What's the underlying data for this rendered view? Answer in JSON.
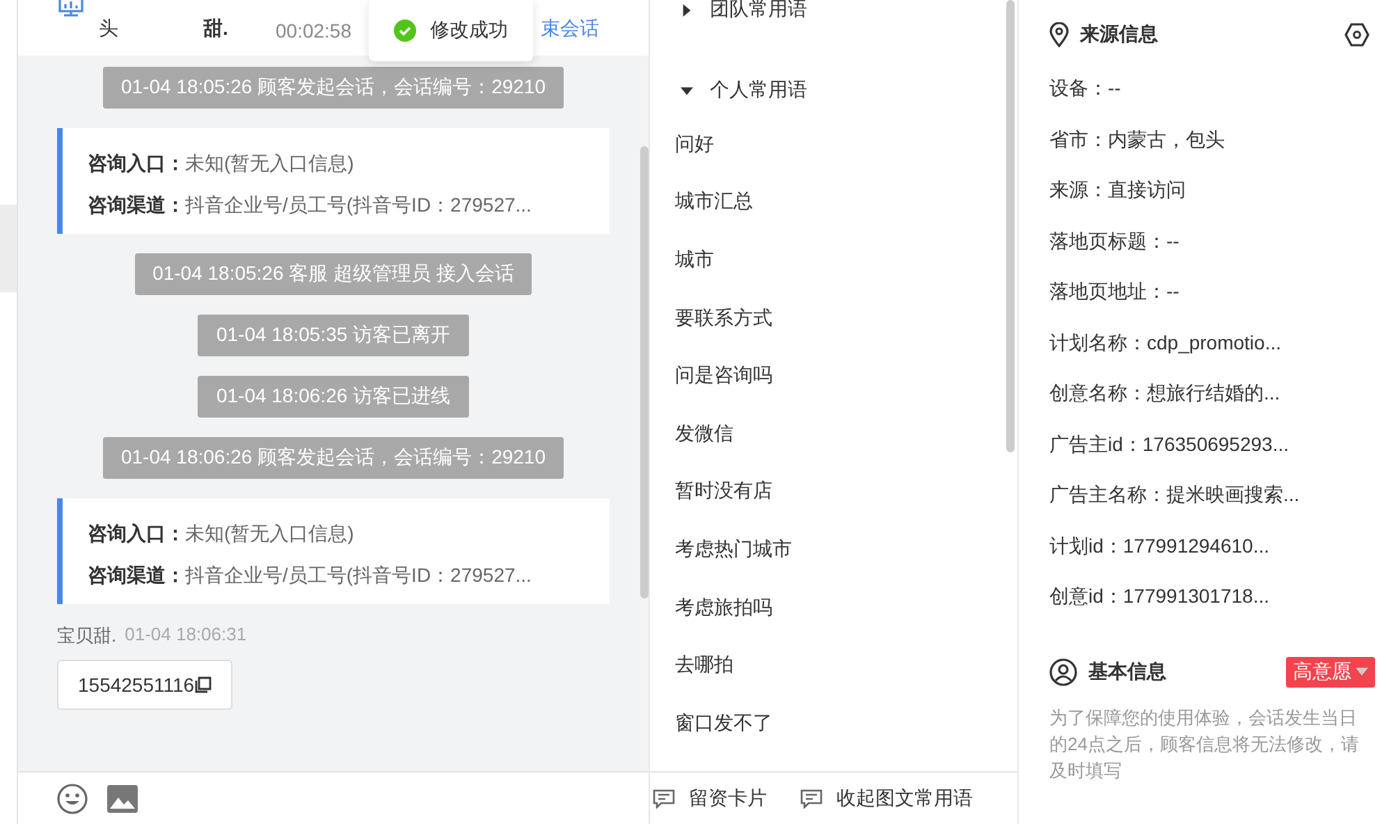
{
  "chat": {
    "header": {
      "name_tail": "头",
      "customer_tail": "甜.",
      "duration": "00:02:58",
      "end_link": "束会话"
    },
    "toast": {
      "text": "修改成功"
    },
    "messages": [
      {
        "kind": "system",
        "text": "01-04 18:05:26 顾客发起会话，会话编号：29210"
      },
      {
        "kind": "info",
        "lines": [
          {
            "label": "咨询入口：",
            "value": "未知(暂无入口信息)"
          },
          {
            "label": "咨询渠道：",
            "value": "抖音企业号/员工号(抖音号ID：279527..."
          }
        ]
      },
      {
        "kind": "system",
        "text": "01-04 18:05:26 客服 超级管理员 接入会话"
      },
      {
        "kind": "system",
        "text": "01-04 18:05:35 访客已离开"
      },
      {
        "kind": "system",
        "text": "01-04 18:06:26 访客已进线"
      },
      {
        "kind": "system",
        "text": "01-04 18:06:26 顾客发起会话，会话编号：29210"
      },
      {
        "kind": "info",
        "lines": [
          {
            "label": "咨询入口：",
            "value": "未知(暂无入口信息)"
          },
          {
            "label": "咨询渠道：",
            "value": "抖音企业号/员工号(抖音号ID：279527..."
          }
        ]
      },
      {
        "kind": "customer",
        "sender": "宝贝甜.",
        "time": "01-04 18:06:31",
        "text": "15542551116"
      }
    ]
  },
  "phrases": {
    "groups": [
      {
        "label": "团队常用语",
        "expanded": false
      },
      {
        "label": "个人常用语",
        "expanded": true,
        "children": [
          "问好",
          "城市汇总",
          "城市",
          "要联系方式",
          "问是咨询吗",
          "发微信",
          "暂时没有店",
          "考虑热门城市",
          "考虑旅拍吗",
          "去哪拍",
          "窗口发不了"
        ]
      }
    ],
    "footer": [
      "留资卡片",
      "收起图文常用语"
    ]
  },
  "source_info": {
    "title": "来源信息",
    "fields": [
      "设备：--",
      "省市：内蒙古，包头",
      "来源：直接访问",
      "落地页标题：--",
      "落地页地址：--",
      "计划名称：cdp_promotio...",
      "创意名称：想旅行结婚的...",
      "广告主id：176350695293...",
      "广告主名称：提米映画搜索...",
      "计划id：177991294610...",
      "创意id：177991301718..."
    ]
  },
  "basic_info": {
    "title": "基本信息",
    "tag": "高意愿",
    "note": "为了保障您的使用体验，会话发生当日的24点之后，顾客信息将无法修改，请及时填写"
  }
}
